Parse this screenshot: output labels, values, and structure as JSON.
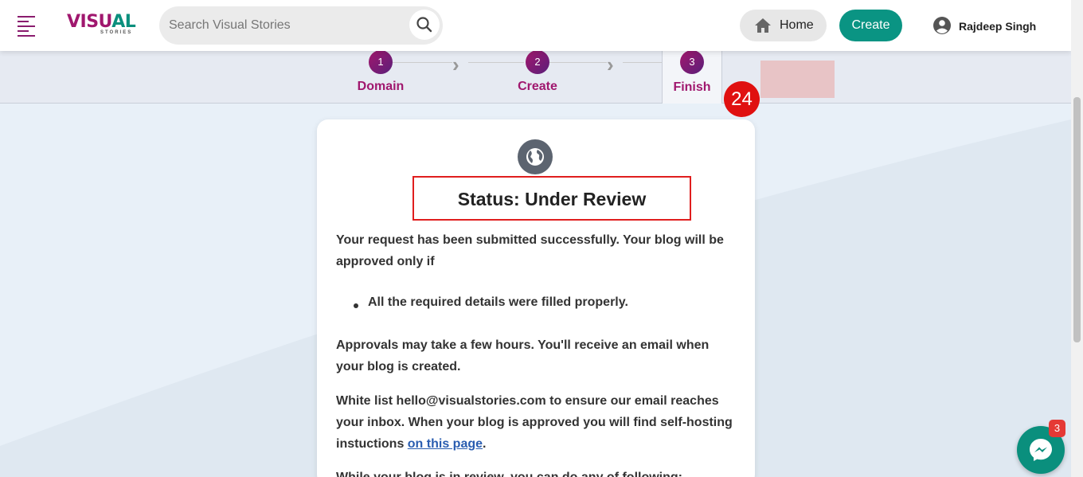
{
  "header": {
    "logo_text_a": "VISU",
    "logo_text_b": "AL",
    "logo_sub": "STORIES",
    "search_placeholder": "Search Visual Stories",
    "home_label": "Home",
    "create_label": "Create",
    "user_name": "Rajdeep Singh"
  },
  "steps": [
    {
      "num": "1",
      "label": "Domain"
    },
    {
      "num": "2",
      "label": "Create"
    },
    {
      "num": "3",
      "label": "Finish"
    }
  ],
  "annotation_badge": "24",
  "card": {
    "status_title": "Status: Under Review",
    "para1": "Your request has been submitted successfully. Your blog will be approved only if",
    "bullet1": "All the required details were filled properly.",
    "para2": "Approvals may take a few hours. You'll receive an email when your blog is created.",
    "para3_prefix": "White list hello@visualstories.com to ensure our email reaches your inbox. When your blog is approved you will find self-hosting instuctions ",
    "para3_link": "on this page",
    "para3_suffix": ".",
    "para4": "While your blog is in review, you can do any of following:"
  },
  "messenger_badge": "3",
  "colors": {
    "brand": "#a0176e",
    "accent": "#0a9483",
    "annotation": "#e01010"
  }
}
